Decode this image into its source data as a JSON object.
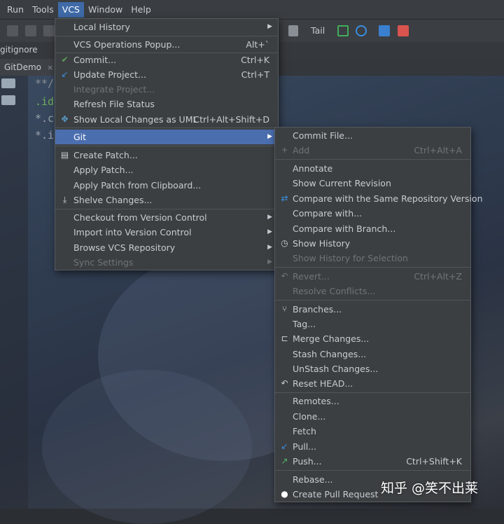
{
  "menubar": {
    "items": [
      {
        "label": "Run"
      },
      {
        "label": "Tools"
      },
      {
        "label": "VCS"
      },
      {
        "label": "Window"
      },
      {
        "label": "Help"
      }
    ]
  },
  "toolbar": {
    "tail_label": "Tail"
  },
  "path": {
    "file": "gitignore"
  },
  "tab": {
    "label": "GitDemo",
    "close": "×"
  },
  "editor": {
    "lines": [
      "**/",
      ".id",
      "*.c",
      "*.i"
    ]
  },
  "vcs_menu": {
    "items": [
      {
        "label": "Local History",
        "submenu": true
      },
      {
        "label": "VCS Operations Popup...",
        "shortcut": "Alt+`"
      },
      {
        "label": "Commit...",
        "shortcut": "Ctrl+K",
        "icon": "check-icon"
      },
      {
        "label": "Update Project...",
        "shortcut": "Ctrl+T",
        "icon": "update-arrow-icon"
      },
      {
        "label": "Integrate Project...",
        "disabled": true
      },
      {
        "label": "Refresh File Status"
      },
      {
        "label": "Show Local Changes as UML",
        "shortcut": "Ctrl+Alt+Shift+D",
        "icon": "uml-icon"
      },
      {
        "label": "Git",
        "submenu": true,
        "selected": true
      },
      {
        "label": "Create Patch...",
        "icon": "patch-icon"
      },
      {
        "label": "Apply Patch..."
      },
      {
        "label": "Apply Patch from Clipboard..."
      },
      {
        "label": "Shelve Changes...",
        "icon": "shelve-icon"
      },
      {
        "label": "Checkout from Version Control",
        "submenu": true
      },
      {
        "label": "Import into Version Control",
        "submenu": true
      },
      {
        "label": "Browse VCS Repository",
        "submenu": true
      },
      {
        "label": "Sync Settings",
        "submenu": true,
        "disabled": true
      }
    ]
  },
  "git_menu": {
    "items": [
      {
        "label": "Commit File..."
      },
      {
        "label": "Add",
        "shortcut": "Ctrl+Alt+A",
        "disabled": true,
        "icon": "plus-icon"
      },
      {
        "label": "Annotate"
      },
      {
        "label": "Show Current Revision"
      },
      {
        "label": "Compare with the Same Repository Version",
        "icon": "compare-arrows-icon"
      },
      {
        "label": "Compare with..."
      },
      {
        "label": "Compare with Branch..."
      },
      {
        "label": "Show History",
        "icon": "clock-icon"
      },
      {
        "label": "Show History for Selection",
        "disabled": true
      },
      {
        "label": "Revert...",
        "shortcut": "Ctrl+Alt+Z",
        "disabled": true,
        "icon": "revert-icon"
      },
      {
        "label": "Resolve Conflicts...",
        "disabled": true
      },
      {
        "label": "Branches...",
        "icon": "branch-icon"
      },
      {
        "label": "Tag..."
      },
      {
        "label": "Merge Changes...",
        "icon": "merge-icon"
      },
      {
        "label": "Stash Changes..."
      },
      {
        "label": "UnStash Changes..."
      },
      {
        "label": "Reset HEAD...",
        "icon": "reset-icon"
      },
      {
        "label": "Remotes..."
      },
      {
        "label": "Clone..."
      },
      {
        "label": "Fetch"
      },
      {
        "label": "Pull...",
        "icon": "pull-arrow-icon"
      },
      {
        "label": "Push...",
        "shortcut": "Ctrl+Shift+K",
        "icon": "push-arrow-icon"
      },
      {
        "label": "Rebase..."
      },
      {
        "label": "Create Pull Request",
        "icon": "github-icon"
      }
    ]
  },
  "watermark": {
    "text": "知乎 @笑不出莱"
  },
  "colors": {
    "menu_bg": "#3c3f41",
    "selection": "#4b6eaf",
    "check_green": "#5aa05a",
    "arrow_blue": "#3a8fe0"
  }
}
